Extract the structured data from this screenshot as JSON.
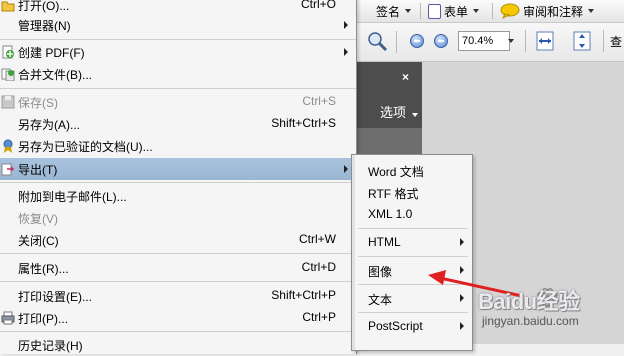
{
  "toolbar": {
    "sign_label": "签名",
    "forms_label": "表单",
    "review_label": "审阅和注释",
    "zoom_value": "70.4%",
    "find_label": "查"
  },
  "pane": {
    "close_glyph": "×",
    "options_label": "选项"
  },
  "main_menu": {
    "items": [
      {
        "label": "打开(O)...",
        "shortcut": "Ctrl+O"
      },
      {
        "label": "管理器(N)",
        "shortcut": ""
      },
      {
        "label": "创建 PDF(F)",
        "shortcut": ""
      },
      {
        "label": "合并文件(B)...",
        "shortcut": ""
      },
      {
        "label": "保存(S)",
        "shortcut": "Ctrl+S"
      },
      {
        "label": "另存为(A)...",
        "shortcut": "Shift+Ctrl+S"
      },
      {
        "label": "另存为已验证的文档(U)...",
        "shortcut": ""
      },
      {
        "label": "导出(T)",
        "shortcut": ""
      },
      {
        "label": "附加到电子邮件(L)...",
        "shortcut": ""
      },
      {
        "label": "恢复(V)",
        "shortcut": ""
      },
      {
        "label": "关闭(C)",
        "shortcut": "Ctrl+W"
      },
      {
        "label": "属性(R)...",
        "shortcut": "Ctrl+D"
      },
      {
        "label": "打印设置(E)...",
        "shortcut": "Shift+Ctrl+P"
      },
      {
        "label": "打印(P)...",
        "shortcut": "Ctrl+P"
      },
      {
        "label": "历史记录(H)",
        "shortcut": ""
      }
    ]
  },
  "export_submenu": {
    "items": [
      {
        "label": "Word 文档"
      },
      {
        "label": "RTF 格式"
      },
      {
        "label": "XML 1.0"
      },
      {
        "label": "HTML"
      },
      {
        "label": "图像"
      },
      {
        "label": "文本"
      },
      {
        "label": "PostScript"
      }
    ]
  },
  "watermark": {
    "brand": "Baidu经验",
    "url": "jingyan.baidu.com"
  },
  "colors": {
    "highlight": "#9bb6d3",
    "annotation_arrow": "#e02020",
    "pane_dark": "#4d4d4d"
  }
}
